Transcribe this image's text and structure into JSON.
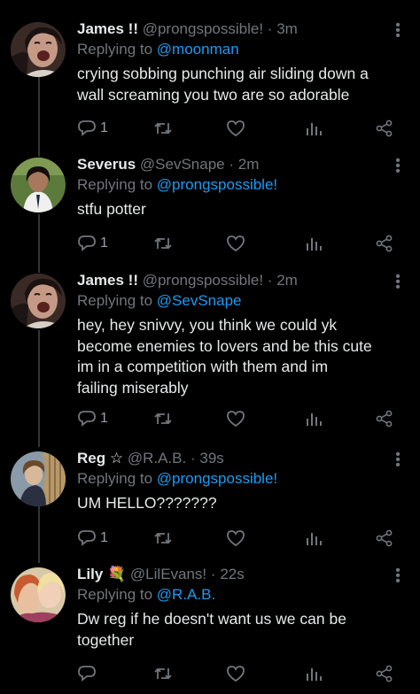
{
  "tweets": [
    {
      "name": "James !!",
      "handle": "@prongspossible!",
      "dot": "·",
      "time": "3m",
      "replying_prefix": "Replying to",
      "replying_to": "@moonman",
      "lines": [
        "crying sobbing punching air sliding down a",
        "wall screaming you two are so adorable"
      ],
      "reply_count": "1",
      "avatar": "avatar-james"
    },
    {
      "name": "Severus",
      "handle": "@SevSnape",
      "dot": "·",
      "time": "2m",
      "replying_prefix": "Replying to",
      "replying_to": "@prongspossible!",
      "lines": [
        "stfu potter"
      ],
      "reply_count": "1",
      "avatar": "avatar-severus"
    },
    {
      "name": "James !!",
      "handle": "@prongspossible!",
      "dot": "·",
      "time": "2m",
      "replying_prefix": "Replying to",
      "replying_to": "@SevSnape",
      "lines": [
        "hey, hey snivvy, you think we could yk",
        "become enemies to lovers and be this cute",
        "im in a competition with them and im",
        "failing miserably"
      ],
      "reply_count": "1",
      "avatar": "avatar-james"
    },
    {
      "name": "Reg ☆",
      "handle": "@R.A.B.",
      "dot": "·",
      "time": "39s",
      "replying_prefix": "Replying to",
      "replying_to": "@prongspossible!",
      "lines": [
        "UM HELLO???????"
      ],
      "reply_count": "1",
      "avatar": "avatar-reg"
    },
    {
      "name": "Lily 💐",
      "handle": "@LilEvans!",
      "dot": "·",
      "time": "22s",
      "replying_prefix": "Replying to",
      "replying_to": "@R.A.B.",
      "lines": [
        "Dw reg if he doesn't want us we can be",
        "together"
      ],
      "reply_count": "",
      "avatar": "avatar-lily"
    }
  ],
  "icons": {
    "reply": "reply-icon",
    "retweet": "retweet-icon",
    "like": "heart-icon",
    "views": "stats-icon",
    "share": "share-icon",
    "more": "more-vertical-icon"
  },
  "colors": {
    "background": "#000000",
    "text": "#e7e9ea",
    "muted": "#71767b",
    "accent": "#1d9bf0",
    "line": "#333639"
  }
}
